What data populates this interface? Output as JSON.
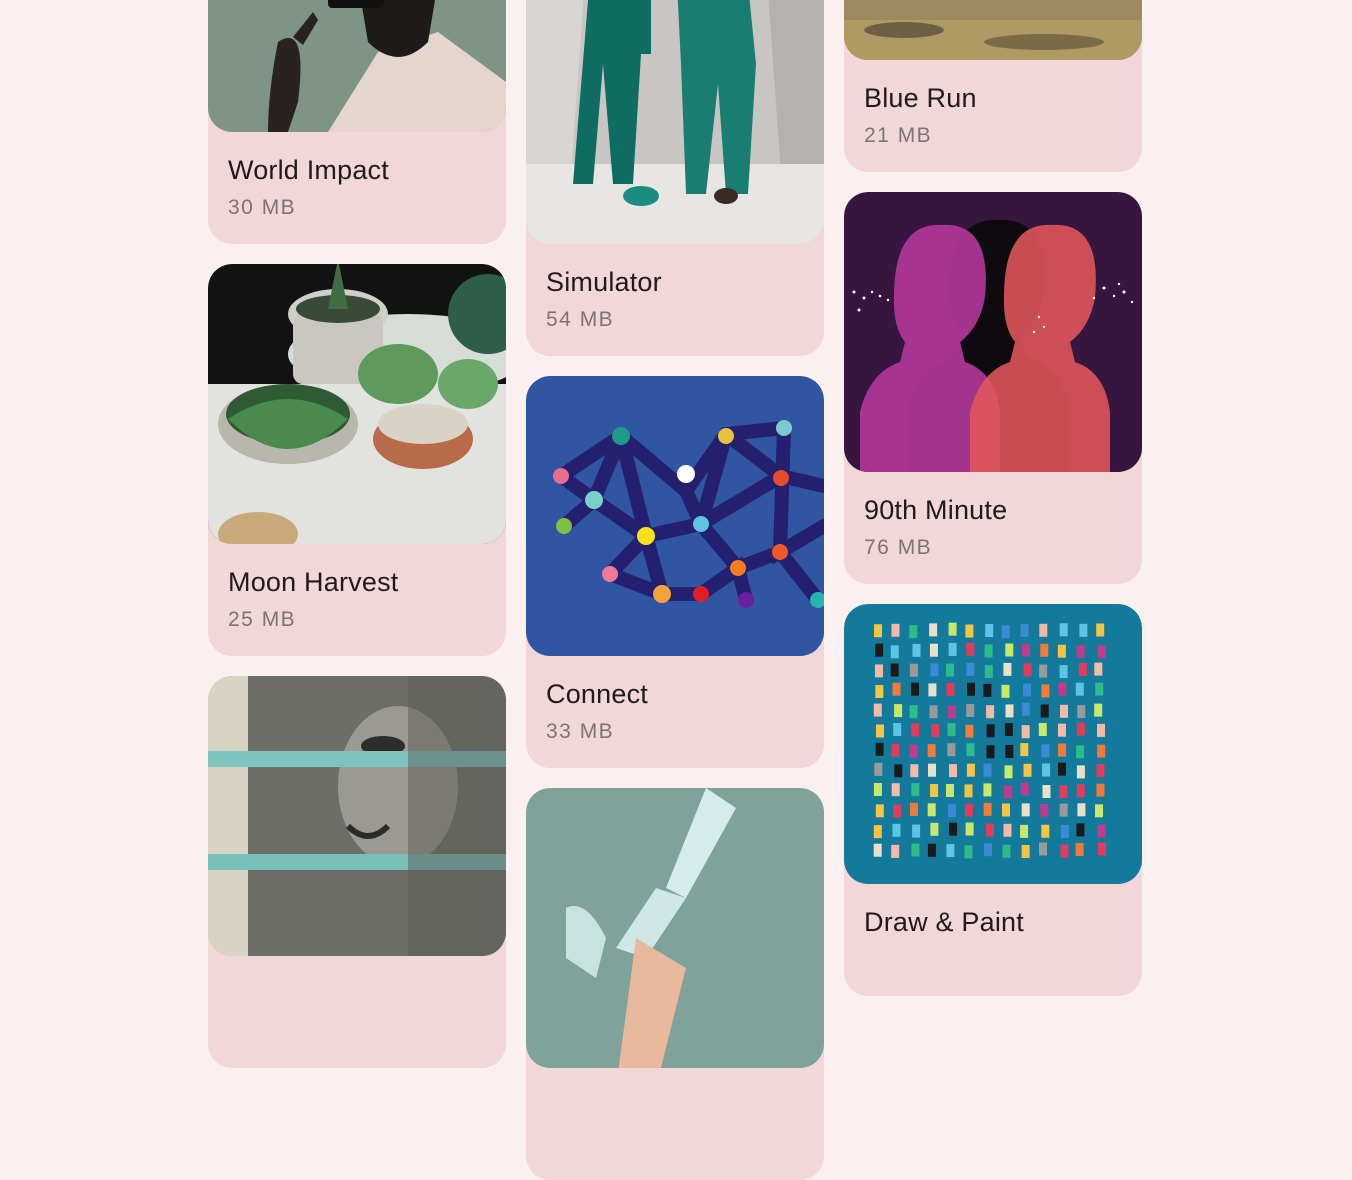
{
  "apps": [
    {
      "title": "World Impact",
      "size": "30 MB",
      "image": "woman-portrait-illustration"
    },
    {
      "title": "Moon Harvest",
      "size": "25 MB",
      "image": "potted-succulents-photo"
    },
    {
      "title": "",
      "size": "",
      "image": "dollar-bill-rubber-bands-photo"
    },
    {
      "title": "Simulator",
      "size": "54 MB",
      "image": "surgeons-hallway-photo"
    },
    {
      "title": "Connect",
      "size": "33 MB",
      "image": "network-nodes-painting"
    },
    {
      "title": "",
      "size": "",
      "image": "hand-glove-photo"
    },
    {
      "title": "Blue Run",
      "size": "21 MB",
      "image": "dry-grass-field-photo"
    },
    {
      "title": "90th Minute",
      "size": "76 MB",
      "image": "silhouettes-illustration"
    },
    {
      "title": "Draw & Paint",
      "size": "",
      "image": "paint-strokes-grid"
    }
  ]
}
